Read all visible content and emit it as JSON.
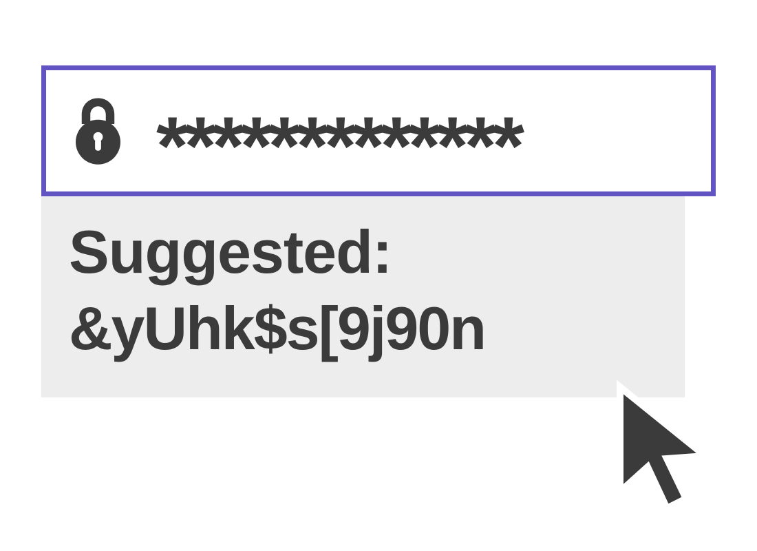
{
  "password_field": {
    "masked_value": "*************"
  },
  "suggestion": {
    "label": "Suggested:",
    "value": "&yUhk$s[9j90n"
  },
  "colors": {
    "accent": "#6354c4",
    "text": "#3b3b3b",
    "panel_bg": "#ededed"
  }
}
